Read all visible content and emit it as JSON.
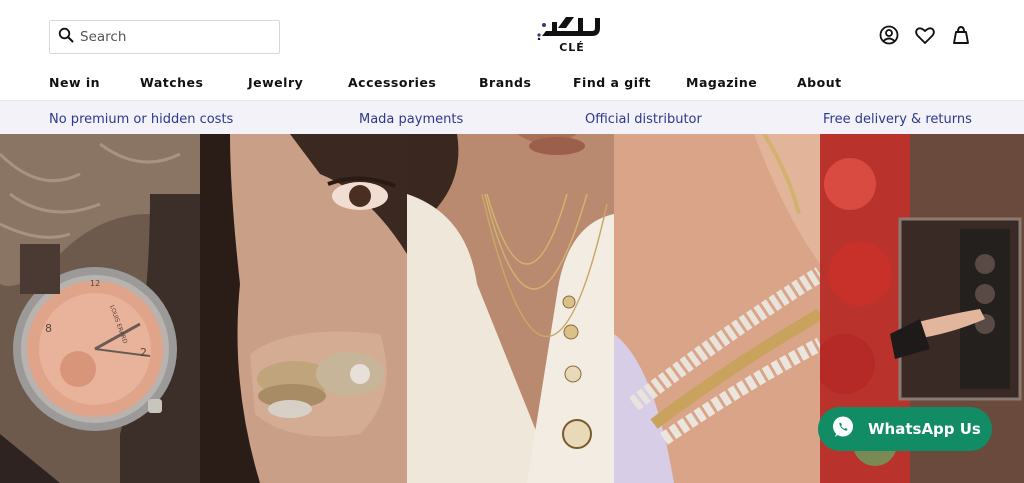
{
  "search": {
    "placeholder": "Search",
    "icon": "search-icon"
  },
  "logo": {
    "arabic_mark": "كلة",
    "text": "CLÉ"
  },
  "header_icons": [
    "account-icon",
    "wishlist-heart-icon",
    "shopping-bag-icon"
  ],
  "nav": {
    "items": [
      "New in",
      "Watches",
      "Jewelry",
      "Accessories",
      "Brands",
      "Find a gift",
      "Magazine",
      "About"
    ]
  },
  "promo": {
    "items": [
      "No premium or hidden costs",
      "Mada payments",
      "Official distributor",
      "Free delivery & returns"
    ],
    "color": "#2d3a8c",
    "background": "#f2f2f8"
  },
  "hero": {
    "tiles": [
      {
        "subject": "watch-on-wrist",
        "watch_brand_mark": "LOUIS ERARD"
      },
      {
        "subject": "model-with-rings"
      },
      {
        "subject": "model-with-necklaces"
      },
      {
        "subject": "diamond-bracelets"
      },
      {
        "subject": "watch-winder-safe"
      }
    ]
  },
  "whatsapp": {
    "label": "WhatsApp Us",
    "color": "#128c64",
    "icon": "whatsapp-icon"
  }
}
